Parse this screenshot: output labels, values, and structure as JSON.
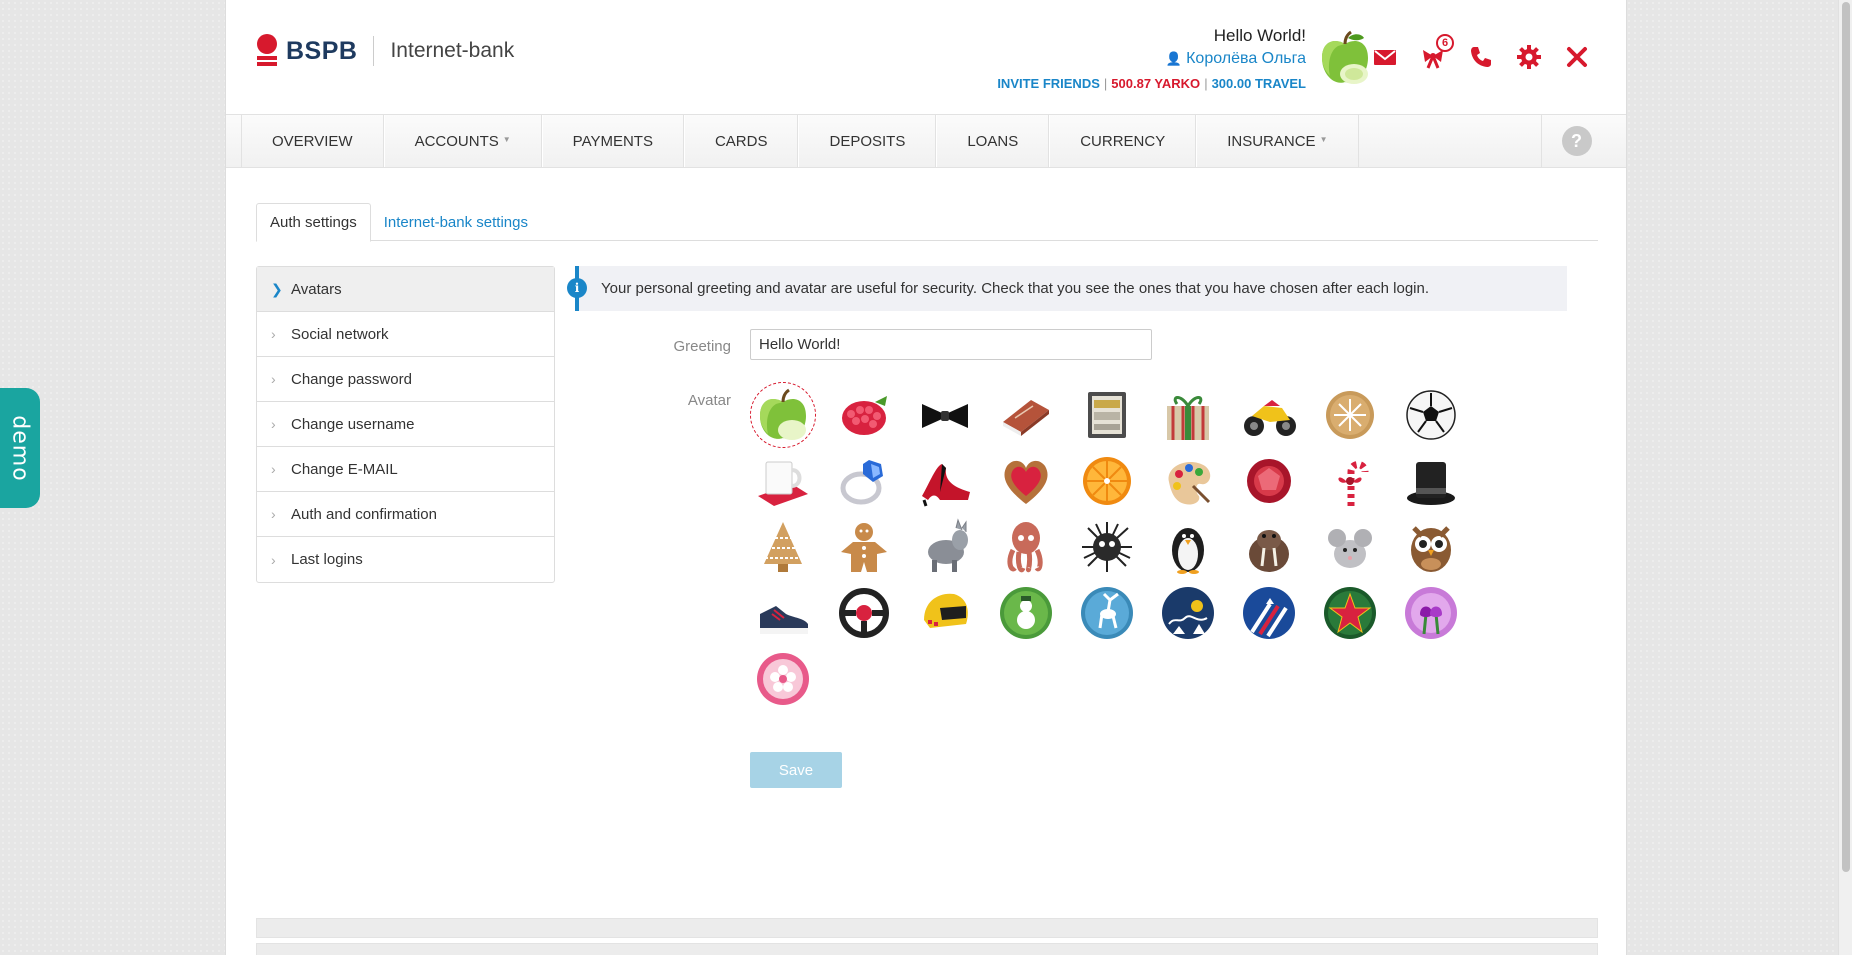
{
  "app": {
    "brand": "BSPB",
    "product": "Internet-bank",
    "demo_label": "demo"
  },
  "user": {
    "greeting": "Hello World!",
    "name": "Королёва Ольга",
    "invite": "INVITE FRIENDS",
    "yarko": "500.87 YARKO",
    "travel": "300.00 TRAVEL",
    "avatar_icon": "green-apple-icon"
  },
  "header_icons": [
    {
      "name": "mail-icon"
    },
    {
      "name": "gift-icon",
      "badge": "6"
    },
    {
      "name": "phone-icon"
    },
    {
      "name": "gear-icon"
    },
    {
      "name": "close-icon"
    }
  ],
  "nav": {
    "items": [
      {
        "label": "OVERVIEW",
        "has_dropdown": false
      },
      {
        "label": "ACCOUNTS",
        "has_dropdown": true
      },
      {
        "label": "PAYMENTS",
        "has_dropdown": false
      },
      {
        "label": "CARDS",
        "has_dropdown": false
      },
      {
        "label": "DEPOSITS",
        "has_dropdown": false
      },
      {
        "label": "LOANS",
        "has_dropdown": false
      },
      {
        "label": "CURRENCY",
        "has_dropdown": false
      },
      {
        "label": "INSURANCE",
        "has_dropdown": true
      }
    ],
    "help": "?",
    "caret": "▼"
  },
  "tabs": [
    {
      "label": "Auth settings",
      "active": true
    },
    {
      "label": "Internet-bank settings",
      "active": false
    }
  ],
  "sidebar": {
    "items": [
      {
        "label": "Avatars",
        "active": true
      },
      {
        "label": "Social network",
        "active": false
      },
      {
        "label": "Change password",
        "active": false
      },
      {
        "label": "Change username",
        "active": false
      },
      {
        "label": "Change E-MAIL",
        "active": false
      },
      {
        "label": "Auth and confirmation",
        "active": false
      },
      {
        "label": "Last logins",
        "active": false
      }
    ]
  },
  "info": {
    "text": "Your personal greeting and avatar are useful for security. Check that you see the ones that you have chosen after each login.",
    "icon": "i"
  },
  "form": {
    "greeting_label": "Greeting",
    "greeting_value": "Hello World!",
    "avatar_label": "Avatar",
    "save_label": "Save"
  },
  "avatars": [
    "apple-icon",
    "raspberry-icon",
    "bow-tie-icon",
    "book-icon",
    "safe-icon",
    "gift-box-icon",
    "motorcycle-icon",
    "cookie-icon",
    "soccer-ball-icon",
    "mug-icon",
    "ring-icon",
    "high-heel-icon",
    "heart-cookie-icon",
    "orange-icon",
    "paint-palette-icon",
    "gem-icon",
    "candy-cane-icon",
    "top-hat-icon",
    "christmas-tree-cookie-icon",
    "gingerbread-man-icon",
    "donkey-icon",
    "octopus-icon",
    "hedgehog-icon",
    "penguin-icon",
    "walrus-icon",
    "mouse-icon",
    "owl-icon",
    "sneaker-icon",
    "steering-wheel-icon",
    "helmet-icon",
    "snowman-icon",
    "deer-icon",
    "santa-sleigh-icon",
    "jets-icon",
    "star-icon",
    "tulips-icon",
    "flower-icon"
  ],
  "selected_avatar_index": 0
}
